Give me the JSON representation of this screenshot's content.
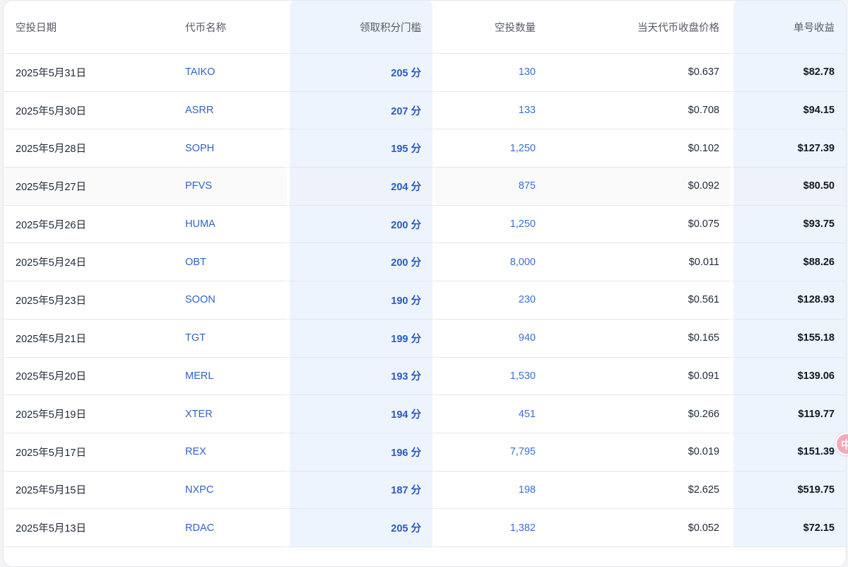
{
  "table": {
    "headers": {
      "date": "空投日期",
      "token": "代币名称",
      "threshold": "领取积分门槛",
      "quantity": "空投数量",
      "price": "当天代币收盘价格",
      "income": "单号收益"
    },
    "rows": [
      {
        "date": "2025年5月31日",
        "token": "TAIKO",
        "threshold": "205 分",
        "quantity": "130",
        "price": "$0.637",
        "income": "$82.78"
      },
      {
        "date": "2025年5月30日",
        "token": "ASRR",
        "threshold": "207 分",
        "quantity": "133",
        "price": "$0.708",
        "income": "$94.15"
      },
      {
        "date": "2025年5月28日",
        "token": "SOPH",
        "threshold": "195 分",
        "quantity": "1,250",
        "price": "$0.102",
        "income": "$127.39"
      },
      {
        "date": "2025年5月27日",
        "token": "PFVS",
        "threshold": "204 分",
        "quantity": "875",
        "price": "$0.092",
        "income": "$80.50"
      },
      {
        "date": "2025年5月26日",
        "token": "HUMA",
        "threshold": "200 分",
        "quantity": "1,250",
        "price": "$0.075",
        "income": "$93.75"
      },
      {
        "date": "2025年5月24日",
        "token": "OBT",
        "threshold": "200 分",
        "quantity": "8,000",
        "price": "$0.011",
        "income": "$88.26"
      },
      {
        "date": "2025年5月23日",
        "token": "SOON",
        "threshold": "190 分",
        "quantity": "230",
        "price": "$0.561",
        "income": "$128.93"
      },
      {
        "date": "2025年5月21日",
        "token": "TGT",
        "threshold": "199 分",
        "quantity": "940",
        "price": "$0.165",
        "income": "$155.18"
      },
      {
        "date": "2025年5月20日",
        "token": "MERL",
        "threshold": "193 分",
        "quantity": "1,530",
        "price": "$0.091",
        "income": "$139.06"
      },
      {
        "date": "2025年5月19日",
        "token": "XTER",
        "threshold": "194 分",
        "quantity": "451",
        "price": "$0.266",
        "income": "$119.77"
      },
      {
        "date": "2025年5月17日",
        "token": "REX",
        "threshold": "196 分",
        "quantity": "7,795",
        "price": "$0.019",
        "income": "$151.39"
      },
      {
        "date": "2025年5月15日",
        "token": "NXPC",
        "threshold": "187 分",
        "quantity": "198",
        "price": "$2.625",
        "income": "$519.75"
      },
      {
        "date": "2025年5月13日",
        "token": "RDAC",
        "threshold": "205 分",
        "quantity": "1,382",
        "price": "$0.052",
        "income": "$72.15"
      }
    ]
  },
  "side_badge": {
    "label": "中"
  },
  "colors": {
    "link_blue": "#2f63c8",
    "highlight_column_bg": "#eef4fd",
    "badge_pink": "#f4a9b8"
  }
}
